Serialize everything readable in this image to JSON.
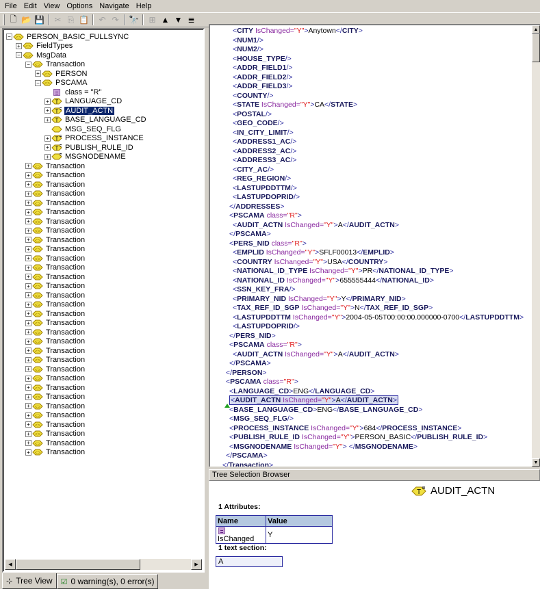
{
  "menubar": {
    "items": [
      "File",
      "Edit",
      "View",
      "Options",
      "Navigate",
      "Help"
    ]
  },
  "toolbar": {
    "buttons": [
      {
        "name": "new-icon",
        "glyph": "🗋",
        "enabled": true
      },
      {
        "name": "open-folder-icon",
        "glyph": "📂",
        "enabled": true
      },
      {
        "name": "save-icon",
        "glyph": "💾",
        "enabled": true
      },
      {
        "name": "cut-icon",
        "glyph": "✂",
        "enabled": false
      },
      {
        "name": "copy-icon",
        "glyph": "⎘",
        "enabled": false
      },
      {
        "name": "paste-icon",
        "glyph": "📋",
        "enabled": false
      },
      {
        "name": "undo-icon",
        "glyph": "↶",
        "enabled": false
      },
      {
        "name": "redo-icon",
        "glyph": "↷",
        "enabled": false
      },
      {
        "name": "find-binoculars-icon",
        "glyph": "🔭",
        "enabled": true
      },
      {
        "name": "tree-add-icon",
        "glyph": "⊞",
        "enabled": false
      },
      {
        "name": "move-up-icon",
        "glyph": "▲",
        "enabled": true
      },
      {
        "name": "move-down-icon",
        "glyph": "▼",
        "enabled": true
      },
      {
        "name": "list-icon",
        "glyph": "≣",
        "enabled": true
      }
    ]
  },
  "tree": {
    "nodes": [
      {
        "label": "PERSON_BASIC_FULLSYNC",
        "depth": 0,
        "expander": "minus",
        "icon": "element"
      },
      {
        "label": "FieldTypes",
        "depth": 1,
        "expander": "plus",
        "icon": "element"
      },
      {
        "label": "MsgData",
        "depth": 1,
        "expander": "minus",
        "icon": "element"
      },
      {
        "label": "Transaction",
        "depth": 2,
        "expander": "minus",
        "icon": "element"
      },
      {
        "label": "PERSON",
        "depth": 3,
        "expander": "plus",
        "icon": "element"
      },
      {
        "label": "PSCAMA",
        "depth": 3,
        "expander": "minus",
        "icon": "element"
      },
      {
        "label": "class = \"R\"",
        "depth": 4,
        "expander": "none",
        "icon": "attribute"
      },
      {
        "label": "LANGUAGE_CD",
        "depth": 4,
        "expander": "plus",
        "icon": "text-element"
      },
      {
        "label": "AUDIT_ACTN",
        "depth": 4,
        "expander": "plus",
        "icon": "text-attr-element",
        "selected": true
      },
      {
        "label": "BASE_LANGUAGE_CD",
        "depth": 4,
        "expander": "plus",
        "icon": "text-element"
      },
      {
        "label": "MSG_SEQ_FLG",
        "depth": 4,
        "expander": "none",
        "icon": "empty-element"
      },
      {
        "label": "PROCESS_INSTANCE",
        "depth": 4,
        "expander": "plus",
        "icon": "text-attr-element"
      },
      {
        "label": "PUBLISH_RULE_ID",
        "depth": 4,
        "expander": "plus",
        "icon": "text-attr-element"
      },
      {
        "label": "MSGNODENAME",
        "depth": 4,
        "expander": "plus",
        "icon": "empty-attr-element"
      }
    ],
    "collapsed_transaction_label": "Transaction",
    "collapsed_transaction_count": 32
  },
  "bottom_tabs": {
    "tree_view": "Tree View",
    "status": "0 warning(s), 0 error(s)"
  },
  "xml": {
    "lines": [
      {
        "indent": 3,
        "tag": "CITY",
        "attr": "IsChanged",
        "val": "Y",
        "text": "Anytown",
        "close": "CITY"
      },
      {
        "indent": 3,
        "tag": "NUM1",
        "selfclose": true
      },
      {
        "indent": 3,
        "tag": "NUM2",
        "selfclose": true
      },
      {
        "indent": 3,
        "tag": "HOUSE_TYPE",
        "selfclose": true
      },
      {
        "indent": 3,
        "tag": "ADDR_FIELD1",
        "selfclose": true
      },
      {
        "indent": 3,
        "tag": "ADDR_FIELD2",
        "selfclose": true
      },
      {
        "indent": 3,
        "tag": "ADDR_FIELD3",
        "selfclose": true
      },
      {
        "indent": 3,
        "tag": "COUNTY",
        "selfclose": true
      },
      {
        "indent": 3,
        "tag": "STATE",
        "attr": "IsChanged",
        "val": "Y",
        "text": "CA",
        "close": "STATE"
      },
      {
        "indent": 3,
        "tag": "POSTAL",
        "selfclose": true
      },
      {
        "indent": 3,
        "tag": "GEO_CODE",
        "selfclose": true
      },
      {
        "indent": 3,
        "tag": "IN_CITY_LIMIT",
        "selfclose": true
      },
      {
        "indent": 3,
        "tag": "ADDRESS1_AC",
        "selfclose": true
      },
      {
        "indent": 3,
        "tag": "ADDRESS2_AC",
        "selfclose": true
      },
      {
        "indent": 3,
        "tag": "ADDRESS3_AC",
        "selfclose": true
      },
      {
        "indent": 3,
        "tag": "CITY_AC",
        "selfclose": true
      },
      {
        "indent": 3,
        "tag": "REG_REGION",
        "selfclose": true
      },
      {
        "indent": 3,
        "tag": "LASTUPDDTTM",
        "selfclose": true
      },
      {
        "indent": 3,
        "tag": "LASTUPDOPRID",
        "selfclose": true
      },
      {
        "indent": 2,
        "endtag": "ADDRESSES"
      },
      {
        "indent": 2,
        "tag": "PSCAMA",
        "attr": "class",
        "val": "R",
        "open": true
      },
      {
        "indent": 3,
        "tag": "AUDIT_ACTN",
        "attr": "IsChanged",
        "val": "Y",
        "text": "A",
        "close": "AUDIT_ACTN"
      },
      {
        "indent": 2,
        "endtag": "PSCAMA"
      },
      {
        "indent": 2,
        "tag": "PERS_NID",
        "attr": "class",
        "val": "R",
        "open": true
      },
      {
        "indent": 3,
        "tag": "EMPLID",
        "attr": "IsChanged",
        "val": "Y",
        "text": "SFLF00013",
        "close": "EMPLID"
      },
      {
        "indent": 3,
        "tag": "COUNTRY",
        "attr": "IsChanged",
        "val": "Y",
        "text": "USA",
        "close": "COUNTRY"
      },
      {
        "indent": 3,
        "tag": "NATIONAL_ID_TYPE",
        "attr": "IsChanged",
        "val": "Y",
        "text": "PR",
        "close": "NATIONAL_ID_TYPE"
      },
      {
        "indent": 3,
        "tag": "NATIONAL_ID",
        "attr": "IsChanged",
        "val": "Y",
        "text": "655555444",
        "close": "NATIONAL_ID"
      },
      {
        "indent": 3,
        "tag": "SSN_KEY_FRA",
        "selfclose": true
      },
      {
        "indent": 3,
        "tag": "PRIMARY_NID",
        "attr": "IsChanged",
        "val": "Y",
        "text": "Y",
        "close": "PRIMARY_NID"
      },
      {
        "indent": 3,
        "tag": "TAX_REF_ID_SGP",
        "attr": "IsChanged",
        "val": "Y",
        "text": "N",
        "close": "TAX_REF_ID_SGP"
      },
      {
        "indent": 3,
        "tag": "LASTUPDDTTM",
        "attr": "IsChanged",
        "val": "Y",
        "text": "2004-05-05T00:00:00.000000-0700",
        "close": "LASTUPDDTTM"
      },
      {
        "indent": 3,
        "tag": "LASTUPDOPRID",
        "selfclose": true
      },
      {
        "indent": 2,
        "endtag": "PERS_NID"
      },
      {
        "indent": 2,
        "tag": "PSCAMA",
        "attr": "class",
        "val": "R",
        "open": true
      },
      {
        "indent": 3,
        "tag": "AUDIT_ACTN",
        "attr": "IsChanged",
        "val": "Y",
        "text": "A",
        "close": "AUDIT_ACTN"
      },
      {
        "indent": 2,
        "endtag": "PSCAMA"
      },
      {
        "indent": 1,
        "endtag": "PERSON"
      },
      {
        "indent": 1,
        "tag": "PSCAMA",
        "attr": "class",
        "val": "R",
        "open": true
      },
      {
        "indent": 2,
        "tag": "LANGUAGE_CD",
        "text": "ENG",
        "close": "LANGUAGE_CD"
      },
      {
        "indent": 2,
        "tag": "AUDIT_ACTN",
        "attr": "IsChanged",
        "val": "Y",
        "text": "A",
        "close": "AUDIT_ACTN",
        "highlight": true
      },
      {
        "indent": 2,
        "tag": "BASE_LANGUAGE_CD",
        "text": "ENG",
        "close": "BASE_LANGUAGE_CD"
      },
      {
        "indent": 2,
        "tag": "MSG_SEQ_FLG",
        "selfclose": true
      },
      {
        "indent": 2,
        "tag": "PROCESS_INSTANCE",
        "attr": "IsChanged",
        "val": "Y",
        "text": "684",
        "close": "PROCESS_INSTANCE"
      },
      {
        "indent": 2,
        "tag": "PUBLISH_RULE_ID",
        "attr": "IsChanged",
        "val": "Y",
        "text": "PERSON_BASIC",
        "close": "PUBLISH_RULE_ID"
      },
      {
        "indent": 2,
        "tag": "MSGNODENAME",
        "attr": "IsChanged",
        "val": "Y",
        "text": " ",
        "close": "MSGNODENAME"
      },
      {
        "indent": 1,
        "endtag": "PSCAMA"
      },
      {
        "indent": 0,
        "endtag": "Transaction"
      }
    ]
  },
  "selection_browser": {
    "header": "Tree Selection Browser",
    "node_name": "AUDIT_ACTN",
    "attributes_label": "1 Attributes:",
    "columns": [
      "Name",
      "Value"
    ],
    "attributes": [
      {
        "name": "IsChanged",
        "value": "Y"
      }
    ],
    "text_section_label": "1 text section:",
    "text_value": "A"
  },
  "colors": {
    "selection": "#0a246a",
    "xml_bracket": "#2a2aa0",
    "xml_tag": "#1a1a5c",
    "xml_attr": "#8a2aa0",
    "xml_value": "#e02020",
    "element_icon": "#f0e040",
    "table_header": "#b4c8e0"
  }
}
